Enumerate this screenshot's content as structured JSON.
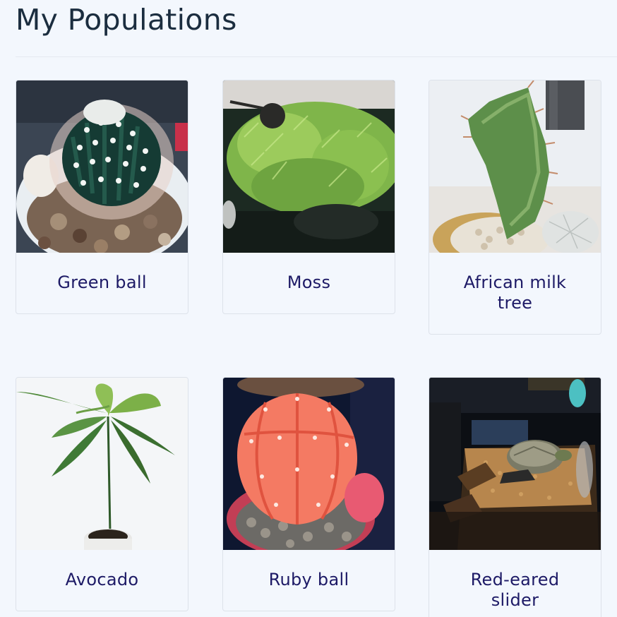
{
  "page": {
    "title": "My Populations"
  },
  "populations": [
    {
      "name": "Green ball",
      "photo": "cactus-green-ball-photo"
    },
    {
      "name": "Moss",
      "photo": "moss-photo"
    },
    {
      "name": "African milk tree",
      "photo": "african-milk-tree-photo"
    },
    {
      "name": "Avocado",
      "photo": "avocado-seedling-photo"
    },
    {
      "name": "Ruby ball",
      "photo": "ruby-ball-cactus-photo"
    },
    {
      "name": "Red-eared slider",
      "photo": "turtle-tank-photo"
    }
  ],
  "colors": {
    "background": "#f3f7fd",
    "title": "#1b2d3f",
    "label": "#1d1a66",
    "card_border": "#dde2ea"
  }
}
